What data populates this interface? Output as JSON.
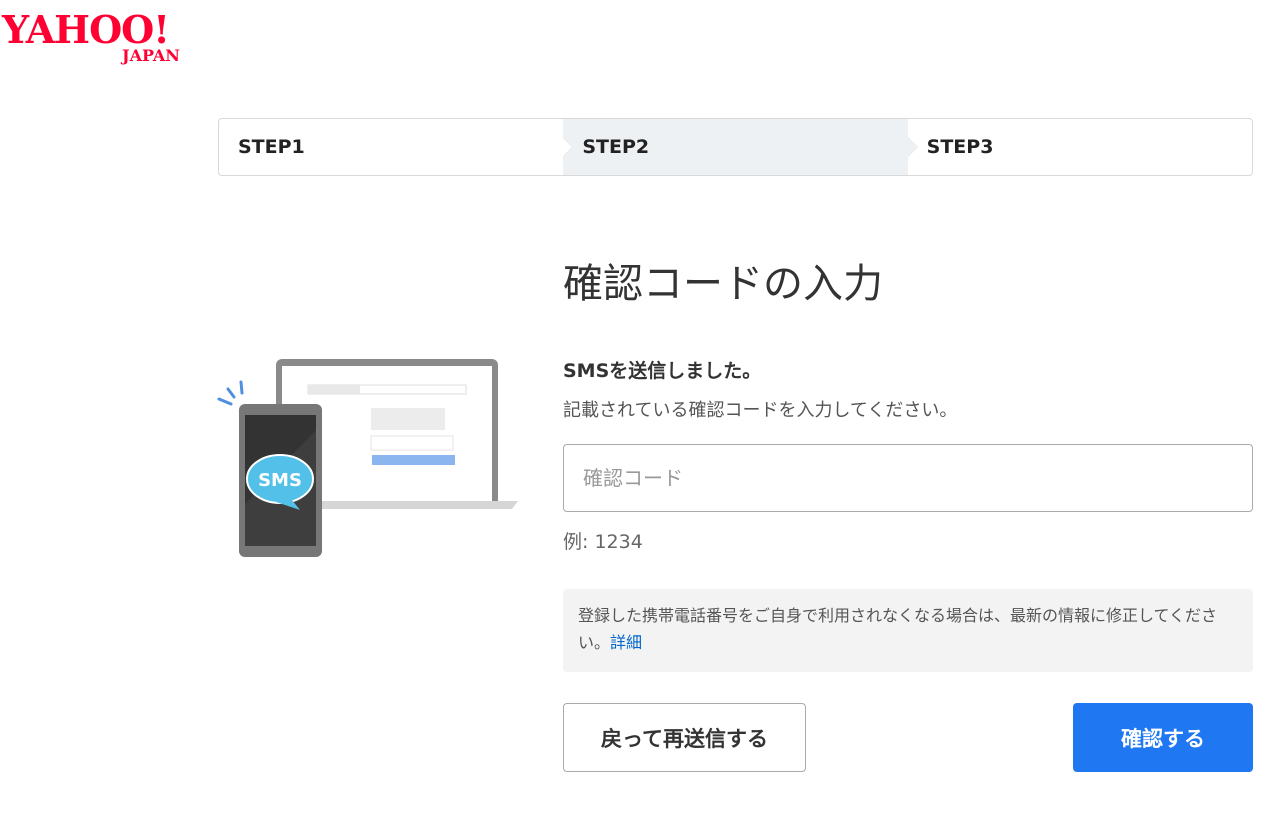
{
  "brand": {
    "logo_main": "YAHOO!",
    "logo_sub": "JAPAN",
    "color": "#ff0033"
  },
  "steps": [
    {
      "label": "STEP1",
      "active": false
    },
    {
      "label": "STEP2",
      "active": true
    },
    {
      "label": "STEP3",
      "active": false
    }
  ],
  "illustration": {
    "badge_text": "SMS",
    "badge_color": "#4fbde6"
  },
  "main": {
    "title": "確認コードの入力",
    "sms_sent": "SMSを送信しました。",
    "instruction": "記載されている確認コードを入力してください。",
    "code_input": {
      "placeholder": "確認コード",
      "value": ""
    },
    "example": "例: 1234",
    "notice_text": "登録した携帯電話番号をご自身で利用されなくなる場合は、最新の情報に修正してください。",
    "notice_link": "詳細"
  },
  "buttons": {
    "back_resend": "戻って再送信する",
    "confirm": "確認する",
    "confirm_color": "#1f77f2"
  }
}
